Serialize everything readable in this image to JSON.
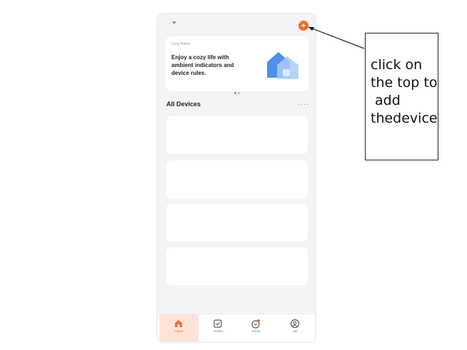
{
  "header": {
    "add_button_label": "+"
  },
  "banner": {
    "tag": "Cozy Home",
    "text": "Enjoy a cozy life with ambient indicators and device rules."
  },
  "devices": {
    "title": "All Devices",
    "more": "····"
  },
  "tabs": [
    {
      "label": "Home",
      "icon": "home-icon",
      "active": true
    },
    {
      "label": "Scene",
      "icon": "scene-checkbox-icon",
      "active": false
    },
    {
      "label": "Smart",
      "icon": "smart-icon",
      "active": false
    },
    {
      "label": "Me",
      "icon": "profile-icon",
      "active": false
    }
  ],
  "annotation": {
    "text": "click on\nthe top to\n add\nthedevice"
  },
  "colors": {
    "accent": "#f26b2e",
    "background": "#f4f4f7",
    "card": "#ffffff"
  }
}
